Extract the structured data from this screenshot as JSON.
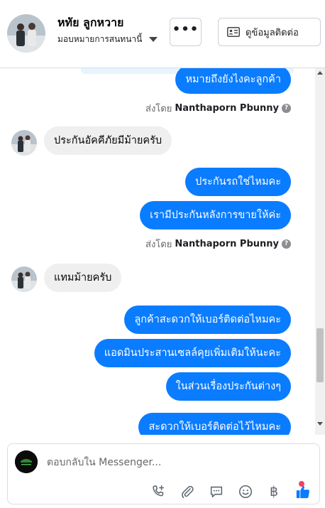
{
  "header": {
    "contact_name": "หทัย ลูกหวาย",
    "assign_label": "มอบหมายการสนทนานี้",
    "more_label": "•••",
    "contact_info_label": "ดูข้อมูลติดต่อ"
  },
  "messages": {
    "m1": "หมายถึงยังไงคะลูกค้า",
    "sent_by_1": {
      "prefix": "ส่งโดย",
      "name": "Nanthaporn Pbunny"
    },
    "m2": "ประกันอัคคีภัยมีม้ายครับ",
    "m3": "ประกันรถใช่ไหมคะ",
    "m4": "เรามีประกันหลังการขายให้ค่ะ",
    "sent_by_2": {
      "prefix": "ส่งโดย",
      "name": "Nanthaporn Pbunny"
    },
    "m5": "แทมม้ายครับ",
    "m6": "ลูกค้าสะดวกให้เบอร์ติดต่อไหมคะ",
    "m7": "แอดมินประสานเซลล์คุยเพิ่มเติมให้นะคะ",
    "m8": "ในส่วนเรื่องประกันต่างๆ",
    "m9": "สะดวกให้เบอร์ติดต่อไว้ไหมคะ"
  },
  "composer": {
    "placeholder": "ตอบกลับใน Messenger...",
    "baht_symbol": "฿"
  },
  "colors": {
    "outgoing_bubble": "#0a7cff",
    "incoming_bubble": "#efefef",
    "like_icon": "#0a7cff",
    "notification_dot": "#f3425f"
  },
  "icons": [
    "more-icon",
    "contact-card-icon",
    "chevron-down-icon",
    "help-icon",
    "add-call-icon",
    "attachment-icon",
    "saved-reply-icon",
    "emoji-icon",
    "baht-icon",
    "thumbs-up-icon"
  ]
}
